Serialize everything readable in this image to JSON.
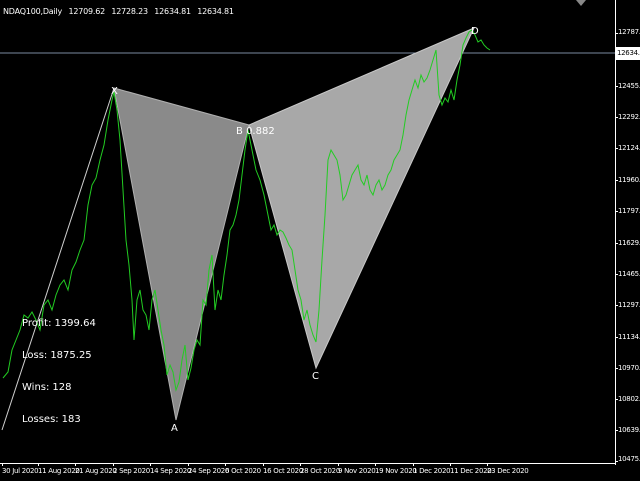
{
  "header": {
    "symbol": "NDAQ100,Daily",
    "open": "12709.62",
    "high": "12728.23",
    "low": "12634.81",
    "close": "12634.81"
  },
  "price_axis": {
    "ticks": [
      "12787.5",
      "12455.8",
      "12292.5",
      "12124.2",
      "11960.8",
      "11797.5",
      "11629.2",
      "11465.8",
      "11297.5",
      "11134.2",
      "10970.8",
      "10802.5",
      "10639.2",
      "10475.8"
    ],
    "current_price": "12634.8"
  },
  "time_axis": {
    "ticks": [
      "30 Jul 2020",
      "11 Aug 2020",
      "21 Aug 2020",
      "2 Sep 2020",
      "14 Sep 2020",
      "24 Sep 2020",
      "6 Oct 2020",
      "16 Oct 2020",
      "28 Oct 2020",
      "9 Nov 2020",
      "19 Nov 2020",
      "1 Dec 2020",
      "11 Dec 2020",
      "23 Dec 2020"
    ]
  },
  "stats": {
    "profit_label": "Profit:",
    "profit_value": "1399.64",
    "loss_label": "Loss:",
    "loss_value": "1875.25",
    "wins_label": "Wins:",
    "wins_value": "128",
    "losses_label": "Losses:",
    "losses_value": "183"
  },
  "pattern": {
    "x_label": "X",
    "a_label": "A",
    "b_label": "B",
    "b_ratio": "0.882",
    "c_label": "C",
    "d_label": "D"
  },
  "colors": {
    "background": "#000000",
    "price_line": "#22cc22",
    "triangle_xab": "#8a8a8a",
    "triangle_bcd": "#a8a8a8",
    "axis": "#ffffff"
  }
}
